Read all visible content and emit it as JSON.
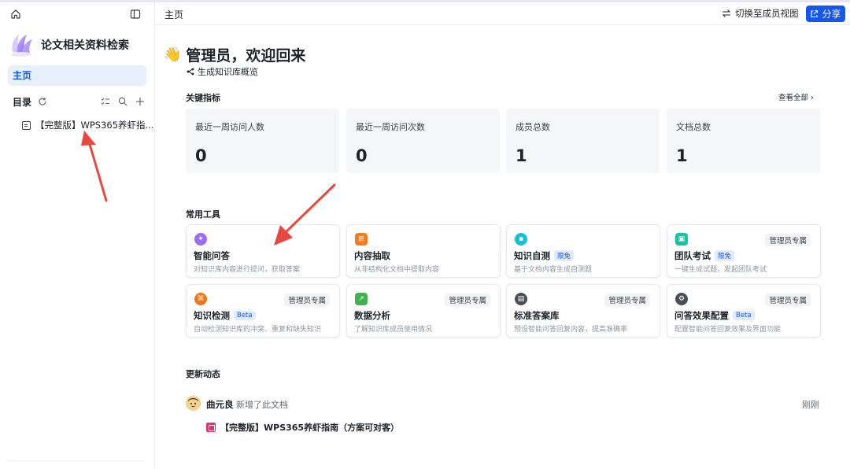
{
  "sidebar": {
    "kb_title": "论文相关资料检索",
    "nav_home": "主页",
    "toc_title": "目录",
    "toc_items": [
      {
        "label": "【完整版】WPS365养虾指..."
      }
    ]
  },
  "header": {
    "breadcrumb": "主页",
    "switch_label": "切换至成员视图",
    "share_label": "分享"
  },
  "welcome": {
    "emoji": "👋",
    "title": "管理员，欢迎回来",
    "generate_label": "生成知识库概览"
  },
  "metrics": {
    "section_title": "关键指标",
    "view_all": "查看全部",
    "items": [
      {
        "label": "最近一周访问人数",
        "value": "0"
      },
      {
        "label": "最近一周访问次数",
        "value": "0"
      },
      {
        "label": "成员总数",
        "value": "1"
      },
      {
        "label": "文档总数",
        "value": "1"
      }
    ]
  },
  "tools": {
    "section_title": "常用工具",
    "admin_label": "管理员专属",
    "items": [
      {
        "name": "智能问答",
        "desc": "对知识库内容进行提问，获取答案",
        "tag": "",
        "admin": false,
        "color": "#9b6cf5",
        "glyph": "✦"
      },
      {
        "name": "内容抽取",
        "desc": "从非结构化文档中提取内容",
        "tag": "",
        "admin": false,
        "color": "#f57b1f",
        "glyph": "⊞"
      },
      {
        "name": "知识自测",
        "desc": "基于文档内容生成自测题",
        "tag": "限免",
        "admin": false,
        "color": "#14c0d6",
        "glyph": "▪"
      },
      {
        "name": "团队考试",
        "desc": "一键生成试题，发起团队考试",
        "tag": "限免",
        "admin": true,
        "color": "#19c2a0",
        "glyph": "▣"
      },
      {
        "name": "知识检测",
        "desc": "自动检测知识库的冲突、重复和缺失知识",
        "tag": "Beta",
        "admin": true,
        "color": "#f0761a",
        "glyph": "⌘"
      },
      {
        "name": "数据分析",
        "desc": "了解知识库成员使用情况",
        "tag": "",
        "admin": true,
        "color": "#3fb34f",
        "glyph": "↗"
      },
      {
        "name": "标准答案库",
        "desc": "预设智能问答回复内容，提高准确率",
        "tag": "",
        "admin": true,
        "color": "#4a4f57",
        "glyph": "▤"
      },
      {
        "name": "问答效果配置",
        "desc": "配置智能问答回复效果及界面功能",
        "tag": "Beta",
        "admin": true,
        "color": "#4a4f57",
        "glyph": "⚙"
      }
    ]
  },
  "activity": {
    "section_title": "更新动态",
    "user": "曲元良",
    "action": "新增了此文档",
    "time": "刚刚",
    "doc_title": "【完整版】WPS365养虾指南（方案可对客）"
  }
}
